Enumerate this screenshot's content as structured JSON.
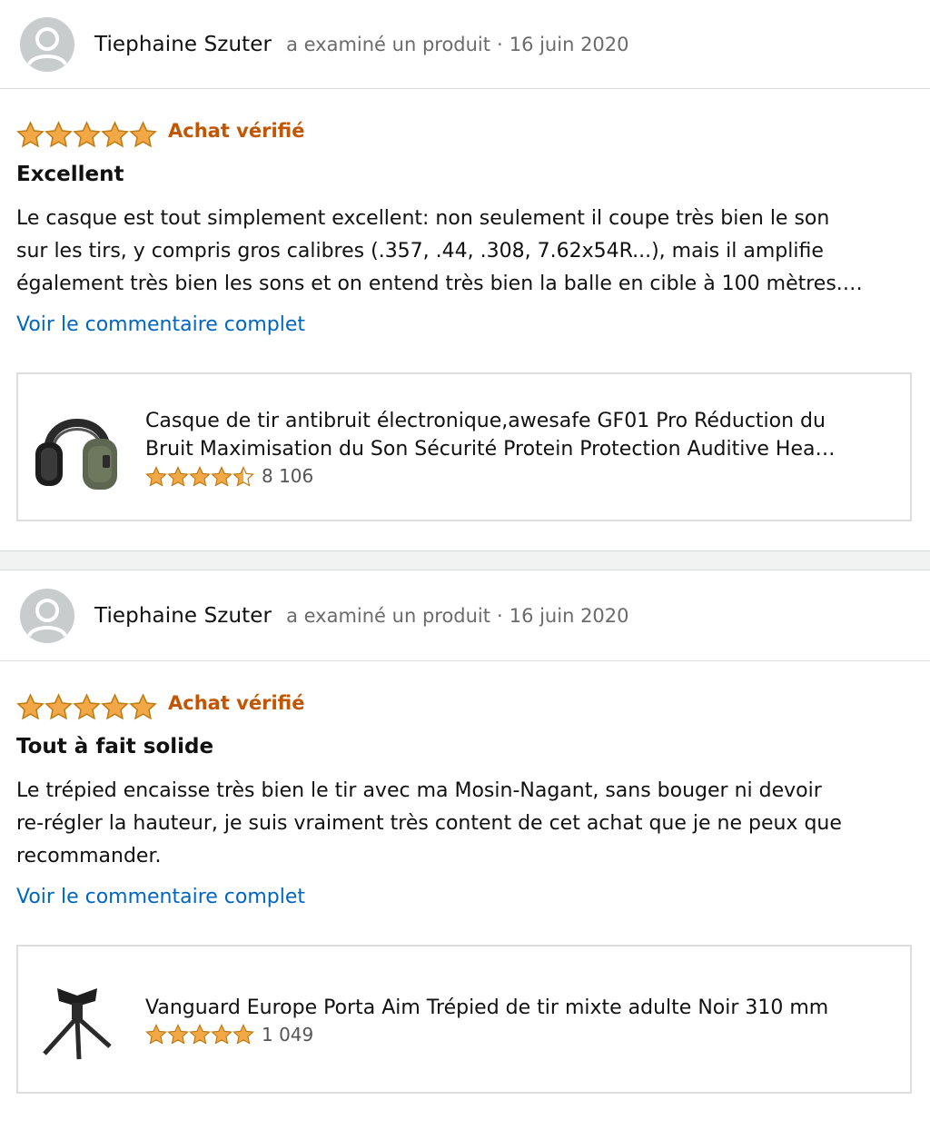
{
  "reviews": [
    {
      "reviewer": "Tiephaine Szuter",
      "action": "a examiné un produit",
      "separator": "·",
      "date": "16 juin 2020",
      "rating": 5,
      "verified": "Achat vérifié",
      "title": "Excellent",
      "text_lines": [
        "Le casque est tout simplement excellent: non seulement il coupe très bien le son",
        "sur les tirs, y compris gros calibres (.357, .44, .308, 7.62x54R...), mais il amplifie",
        "également très bien les sons et on entend très bien la balle en cible à 100 mètres.…"
      ],
      "link": "Voir le commentaire complet",
      "product": {
        "title_lines": [
          "Casque de tir antibruit électronique,awesafe GF01 Pro Réduction du",
          "Bruit Maximisation du Son Sécurité Protein Protection Auditive Hea…"
        ],
        "rating": 4.5,
        "count": "8 106",
        "image_icon": "ear-defender-headset-icon"
      }
    },
    {
      "reviewer": "Tiephaine Szuter",
      "action": "a examiné un produit",
      "separator": "·",
      "date": "16 juin 2020",
      "rating": 5,
      "verified": "Achat vérifié",
      "title": "Tout à fait solide",
      "text_lines": [
        "Le trépied encaisse très bien le tir avec ma Mosin-Nagant, sans bouger ni devoir",
        "re-régler la hauteur, je suis vraiment très content de cet achat que je ne peux que",
        "recommander."
      ],
      "link": "Voir le commentaire complet",
      "product": {
        "title_lines": [
          "Vanguard Europe Porta Aim Trépied de tir mixte adulte Noir 310 mm"
        ],
        "rating": 5,
        "count": "1 049",
        "image_icon": "shooting-tripod-icon"
      }
    }
  ],
  "colors": {
    "star": "#f3a847",
    "star_stroke": "#c07b12",
    "verified": "#c45500",
    "link": "#0066c0",
    "meta": "#6b6b6b",
    "border": "#dddddd"
  }
}
